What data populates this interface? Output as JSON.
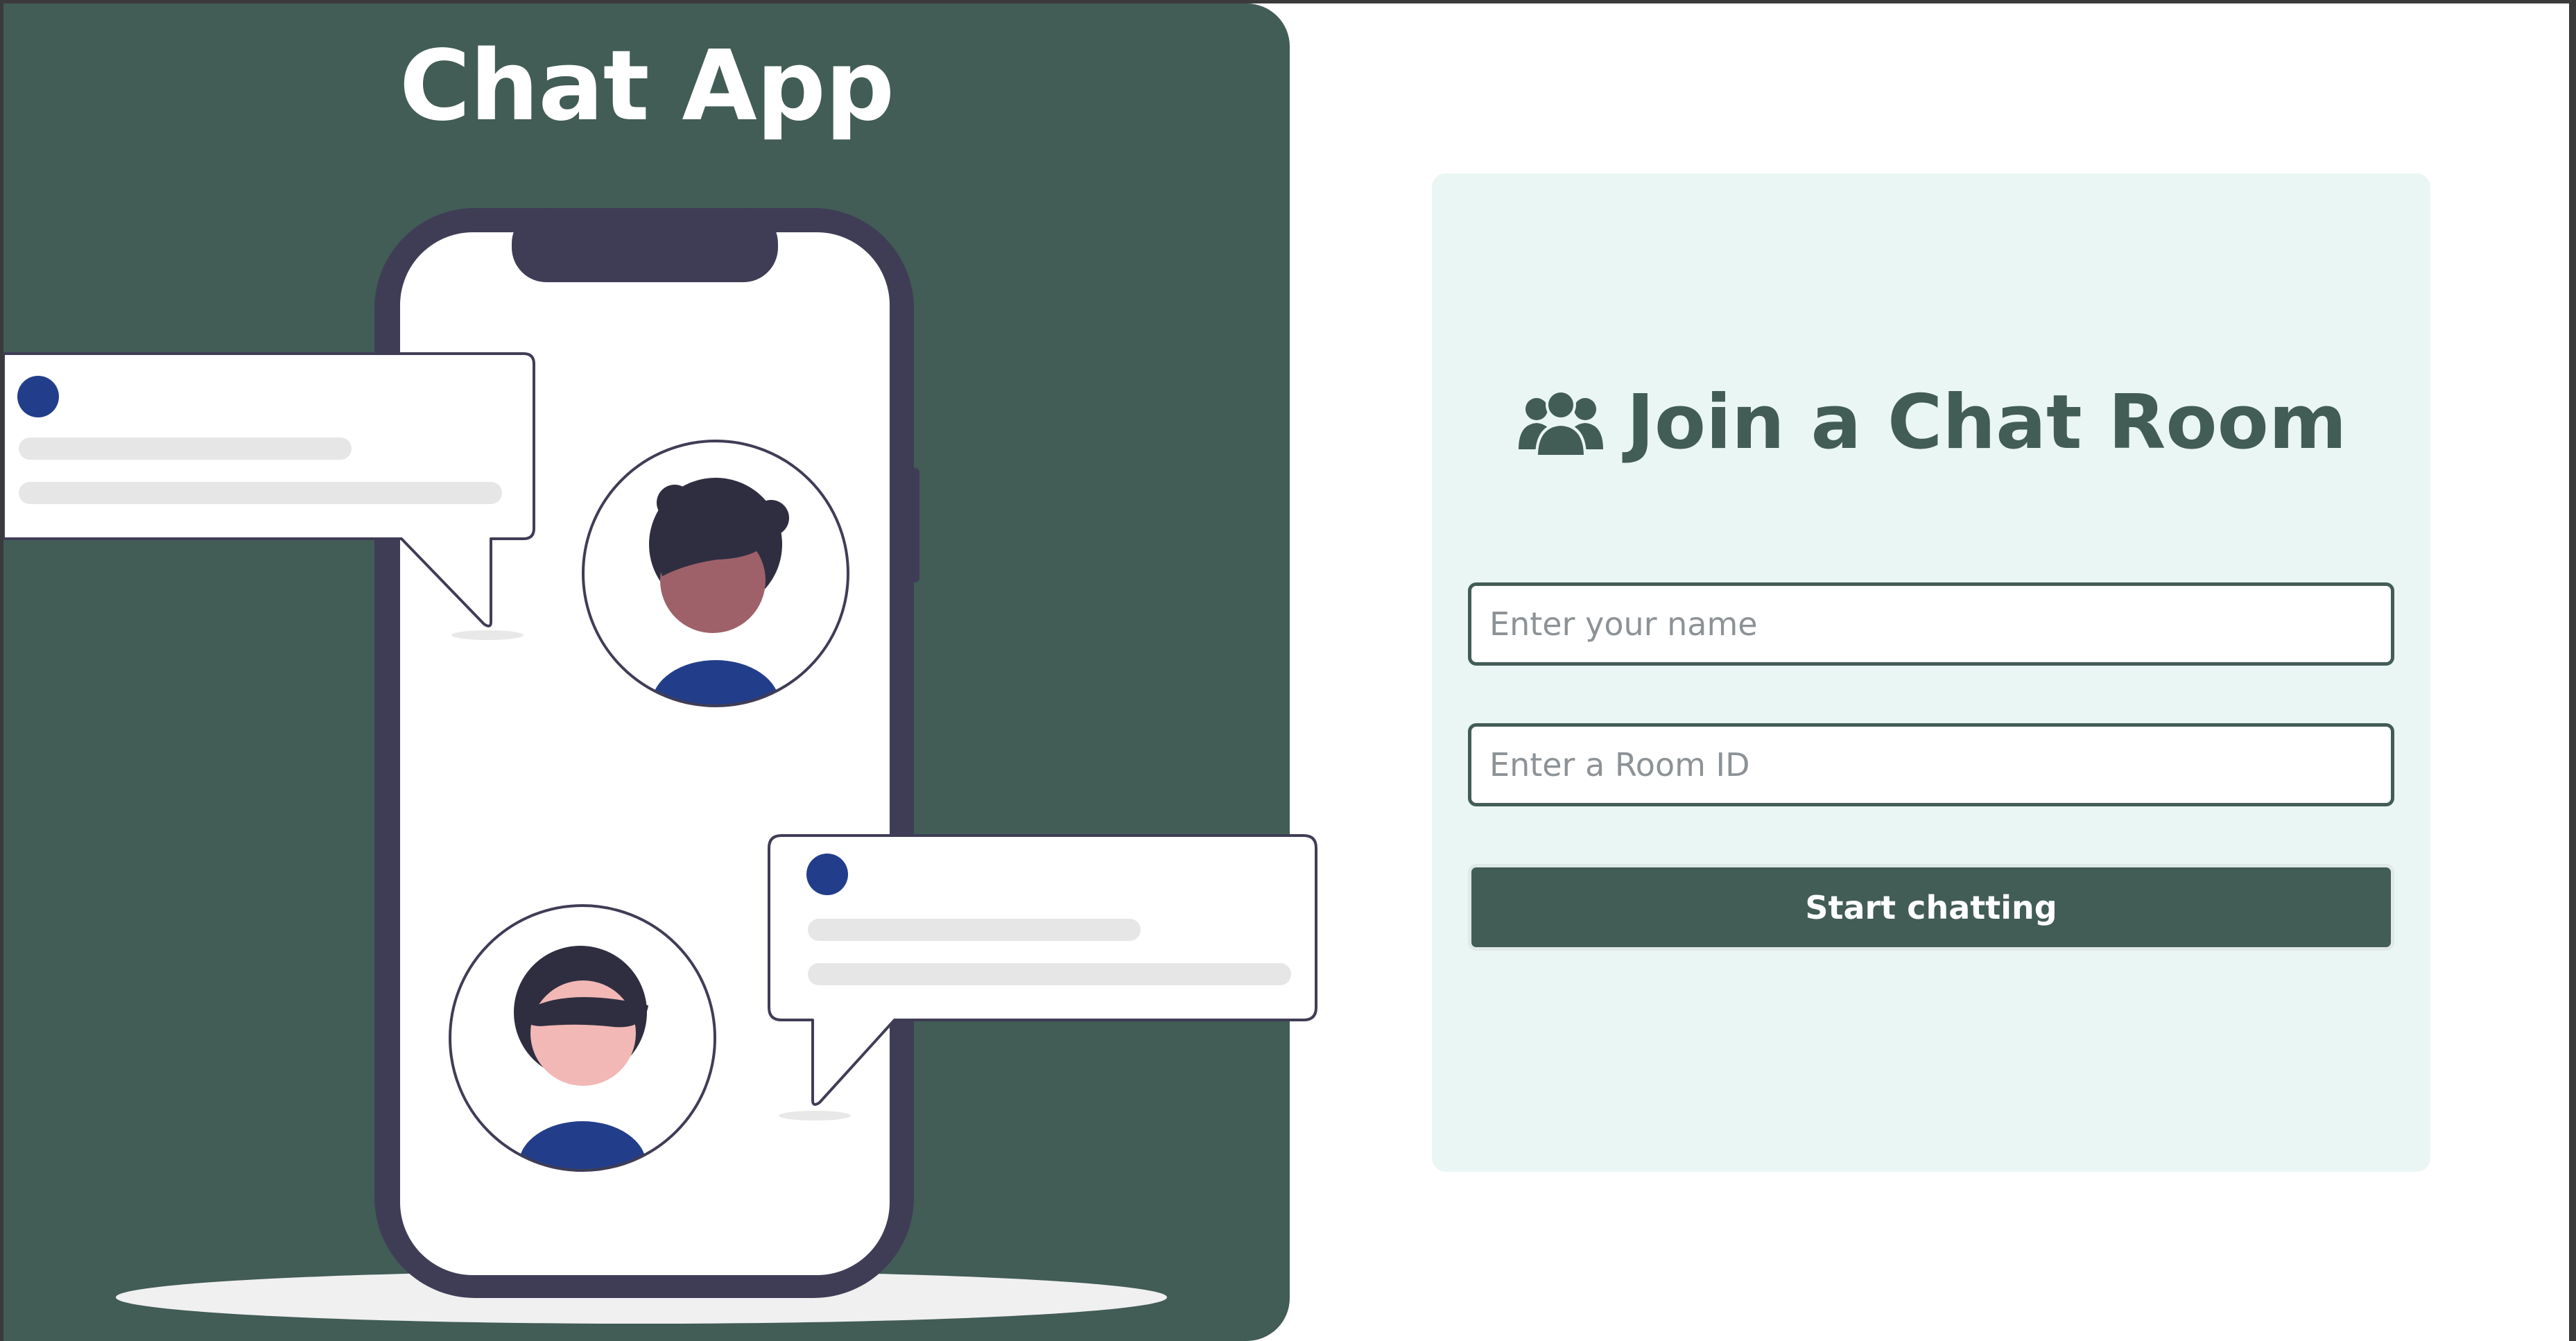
{
  "hero": {
    "title": "Chat App",
    "illustration_icon": "phone-chat-illustration"
  },
  "join_card": {
    "heading": "Join a Chat Room",
    "heading_icon": "users-icon",
    "name_placeholder": "Enter your name",
    "name_value": "",
    "room_placeholder": "Enter a Room ID",
    "room_value": "",
    "submit_label": "Start chatting"
  },
  "colors": {
    "brand": "#425c56",
    "card_background": "#eaf6f4",
    "phone_frame": "#3f3d56",
    "avatar_shirt": "#223e8a",
    "placeholder_bar": "#e6e6e6"
  }
}
